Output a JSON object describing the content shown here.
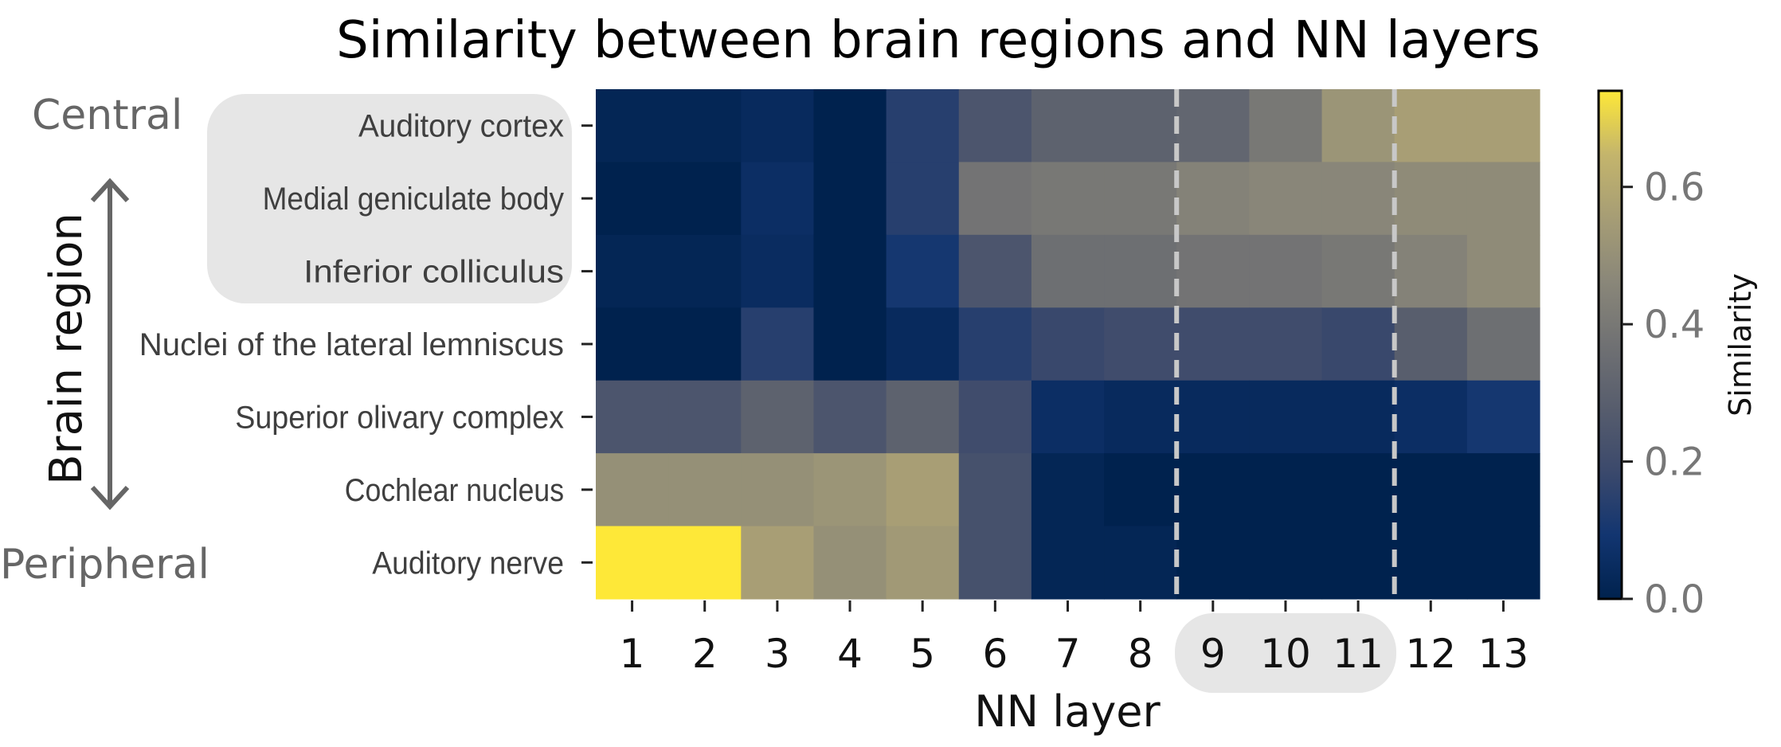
{
  "chart_data": {
    "type": "heatmap",
    "title": "Similarity between brain regions and NN layers",
    "xlabel": "NN layer",
    "ylabel": "Brain region",
    "x_categories": [
      "1",
      "2",
      "3",
      "4",
      "5",
      "6",
      "7",
      "8",
      "9",
      "10",
      "11",
      "12",
      "13"
    ],
    "y_categories": [
      "Auditory cortex",
      "Medial geniculate body",
      "Inferior colliculus",
      "Nuclei of the lateral lemniscus",
      "Superior olivary complex",
      "Cochlear nucleus",
      "Auditory nerve"
    ],
    "y_end_labels": {
      "top": "Central",
      "bottom": "Peripheral"
    },
    "highlighted_rows": [
      "Auditory cortex",
      "Medial geniculate body",
      "Inferior colliculus"
    ],
    "highlighted_columns": [
      "9",
      "10",
      "11"
    ],
    "dashed_column_boundaries_after": [
      "8",
      "11"
    ],
    "values": [
      [
        0.02,
        0.02,
        0.04,
        0.0,
        0.14,
        0.24,
        0.3,
        0.3,
        0.32,
        0.4,
        0.52,
        0.56,
        0.56
      ],
      [
        0.0,
        0.0,
        0.06,
        0.0,
        0.14,
        0.38,
        0.4,
        0.4,
        0.44,
        0.46,
        0.46,
        0.48,
        0.48
      ],
      [
        0.02,
        0.02,
        0.05,
        0.0,
        0.1,
        0.24,
        0.36,
        0.36,
        0.38,
        0.38,
        0.4,
        0.44,
        0.48
      ],
      [
        0.0,
        0.0,
        0.14,
        0.0,
        0.04,
        0.14,
        0.18,
        0.2,
        0.2,
        0.2,
        0.18,
        0.28,
        0.36
      ],
      [
        0.24,
        0.24,
        0.3,
        0.24,
        0.3,
        0.2,
        0.06,
        0.04,
        0.04,
        0.04,
        0.04,
        0.06,
        0.1
      ],
      [
        0.5,
        0.5,
        0.5,
        0.52,
        0.56,
        0.22,
        0.02,
        0.0,
        0.0,
        0.0,
        0.0,
        0.0,
        0.0
      ],
      [
        0.74,
        0.74,
        0.56,
        0.5,
        0.54,
        0.22,
        0.02,
        0.02,
        0.0,
        0.0,
        0.0,
        0.0,
        0.0
      ]
    ],
    "colormap": "cividis",
    "vmin": 0.0,
    "vmax": 0.74,
    "colorbar": {
      "label": "Similarity",
      "ticks": [
        0.0,
        0.2,
        0.4,
        0.6
      ],
      "tick_labels": [
        "0.0",
        "0.2",
        "0.4",
        "0.6"
      ]
    },
    "grid": false
  }
}
